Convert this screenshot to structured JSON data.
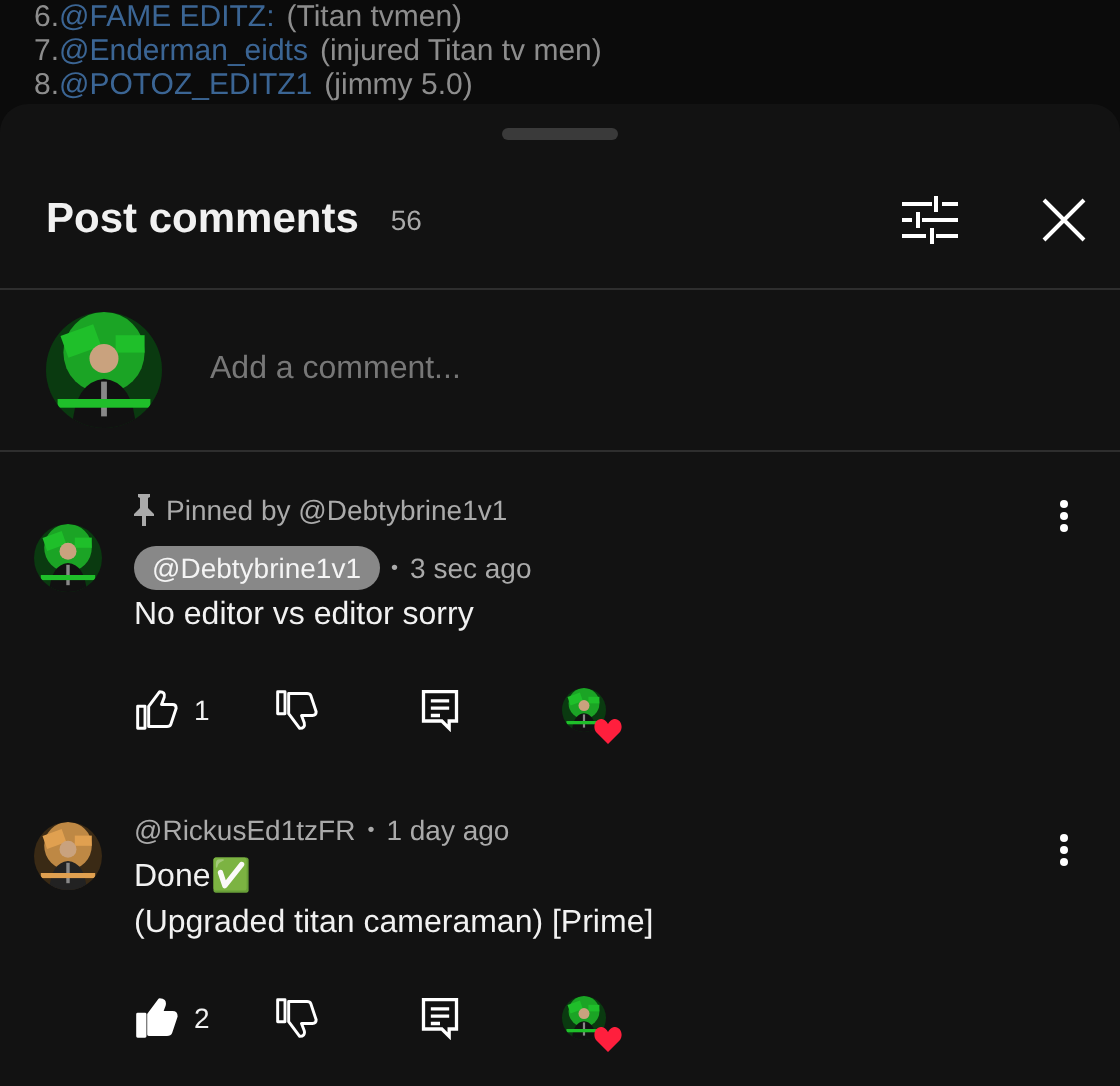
{
  "background_list": [
    {
      "number": "6.",
      "handle": "@FAME EDITZ:",
      "note": "(Titan tvmen)"
    },
    {
      "number": "7.",
      "handle": "@Enderman_eidts",
      "note": "(injured Titan tv men)"
    },
    {
      "number": "8.",
      "handle": "@POTOZ_EDITZ1",
      "note": "(jimmy 5.0)"
    }
  ],
  "sheet": {
    "title": "Post comments",
    "count": "56"
  },
  "composer": {
    "placeholder": "Add a comment..."
  },
  "comments": [
    {
      "pinned": true,
      "pinned_label": "Pinned by @Debtybrine1v1",
      "author": "@Debtybrine1v1",
      "is_creator": true,
      "time": "3 sec ago",
      "lines": [
        "No editor vs editor sorry"
      ],
      "separator": "•",
      "likes": "1",
      "liked": false,
      "hearted": true
    },
    {
      "pinned": false,
      "author": "@RickusEd1tzFR",
      "is_creator": false,
      "time": "1 day ago",
      "lines": [
        "Done✅",
        "(Upgraded titan cameraman) [Prime]"
      ],
      "separator": "•",
      "likes": "2",
      "liked": true,
      "hearted": true
    }
  ]
}
